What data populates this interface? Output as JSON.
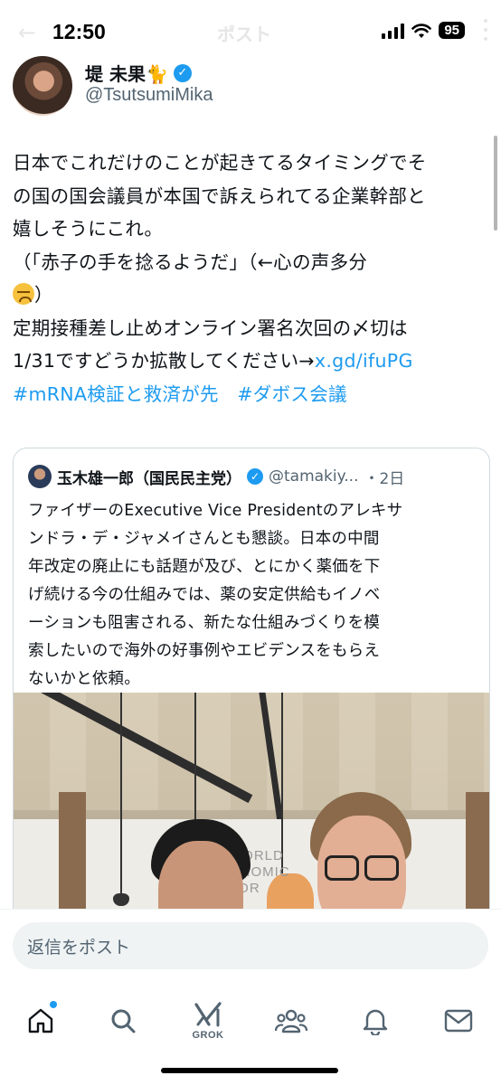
{
  "status_bar": {
    "time": "12:50",
    "battery": "95",
    "header_title": "ポスト"
  },
  "author": {
    "name": "堤 未果🐈",
    "handle": "@TsutsumiMika",
    "verified": true
  },
  "tweet": {
    "lines": [
      "日本でこれだけのことが起きてるタイミングでそ",
      "の国の国会議員が本国で訴えられてる企業幹部と",
      "嬉しそうにこれ。",
      "（「赤子の手を捻るようだ」（←心の声多分",
      "）",
      "定期接種差し止めオンライン署名次回の〆切は",
      "1/31ですどうか拡散してください→"
    ],
    "link": "x.gd/ifuPG",
    "hashtags": [
      "#mRNA検証と救済が先",
      "#ダボス会議"
    ]
  },
  "quoted_tweet": {
    "name": "玉木雄一郎（国民民主党）",
    "handle": "@tamakiy...",
    "time": "・2日",
    "verified": true,
    "lines": [
      "ファイザーのExecutive Vice Presidentのアレキサ",
      "ンドラ・デ・ジャメイさんとも懇談。日本の中間",
      "年改定の廃止にも話題が及び、とにかく薬価を下",
      "げ続ける今の仕組みでは、薬の安定供給もイノベ",
      "ーションも阻害される、新たな仕組みづくりを模",
      "索したいので海外の好事例やエビデンスをもらえ",
      "ないかと依頼。"
    ],
    "photo_sign": [
      "WORLD",
      "ONOMIC",
      "FOR"
    ]
  },
  "reply": {
    "placeholder": "返信をポスト"
  },
  "tabbar": {
    "grok_label": "GROK",
    "items": [
      "home-icon",
      "search-icon",
      "grok-icon",
      "communities-icon",
      "notifications-icon",
      "messages-icon"
    ]
  },
  "colors": {
    "accent": "#1d9bf0",
    "text": "#0f1419",
    "secondary": "#536471"
  }
}
